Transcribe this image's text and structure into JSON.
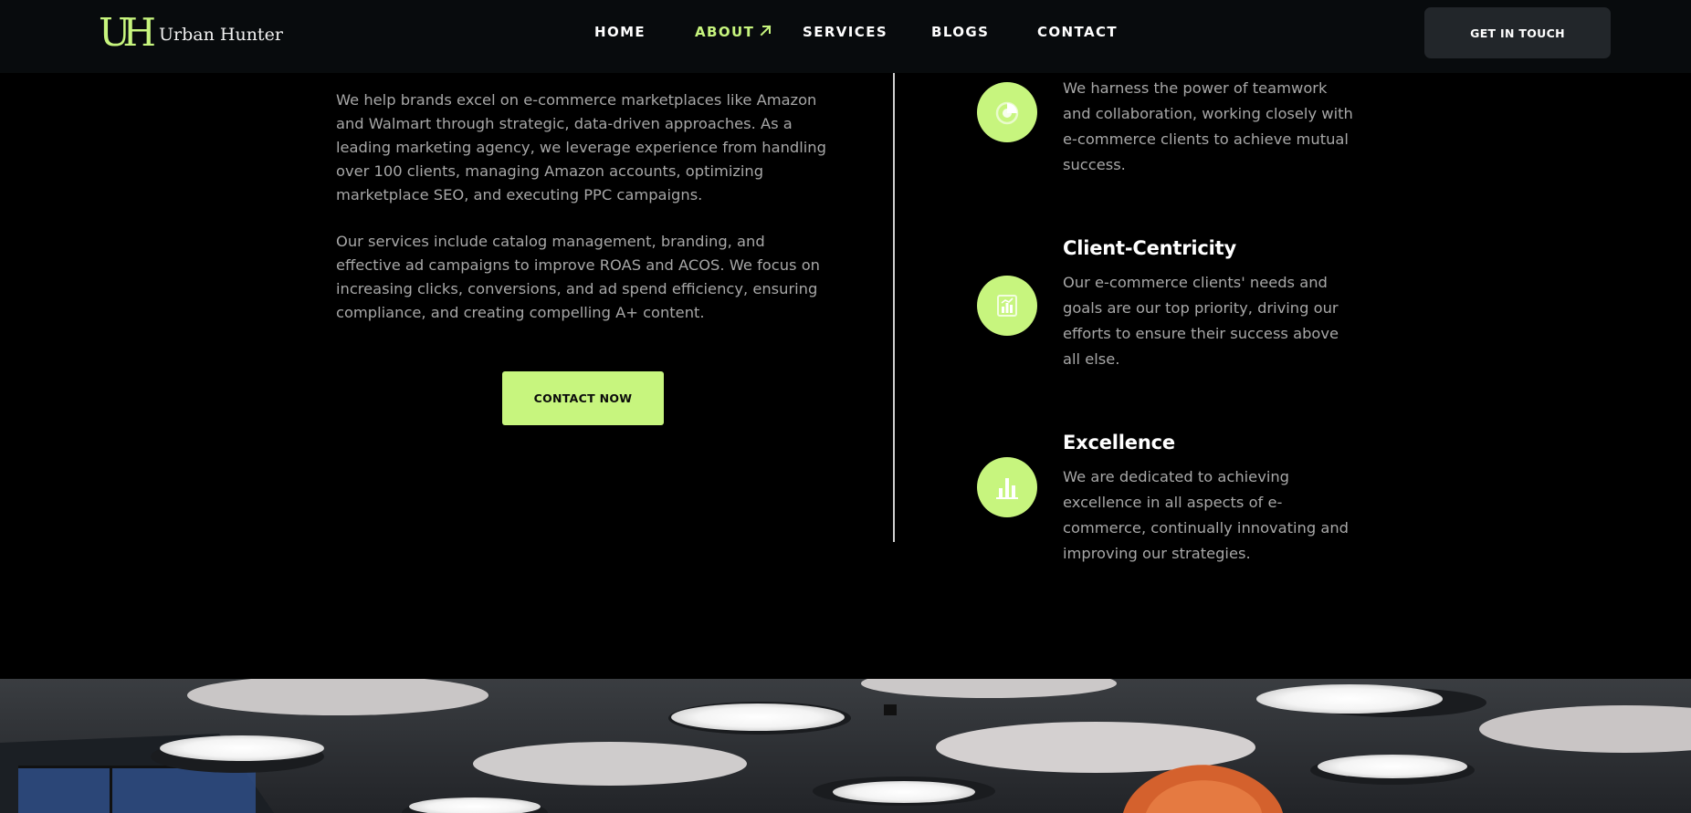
{
  "brand": {
    "mark": "UH",
    "name": "Urban Hunter",
    "accent": "#c7f57e"
  },
  "nav": {
    "items": [
      {
        "label": "HOME",
        "active": false
      },
      {
        "label": "ABOUT",
        "active": true,
        "icon": "arrow-up-right-icon"
      },
      {
        "label": "SERVICES",
        "active": false
      },
      {
        "label": "BLOGS",
        "active": false
      },
      {
        "label": "CONTACT",
        "active": false
      }
    ],
    "cta_label": "GET IN TOUCH"
  },
  "about": {
    "paragraphs": [
      "We help brands excel on e-commerce marketplaces like Amazon and Walmart through strategic, data-driven approaches. As a leading marketing agency, we leverage experience from handling over 100 clients, managing Amazon accounts, optimizing marketplace SEO, and executing PPC campaigns.",
      "Our services include catalog management, branding, and effective ad campaigns to improve ROAS and ACOS. We focus on increasing clicks, conversions, and ad spend efficiency, ensuring compliance, and creating compelling A+ content."
    ],
    "cta_label": "CONTACT NOW"
  },
  "values": [
    {
      "title": "",
      "text": "We harness the power of teamwork and collaboration, working closely with e-commerce clients to achieve mutual success.",
      "icon": "pie-chart-icon"
    },
    {
      "title": "Client-Centricity",
      "text": "Our e-commerce clients' needs and goals are our top priority, driving our efforts to ensure their success above all else.",
      "icon": "report-chart-icon"
    },
    {
      "title": "Excellence",
      "text": "We are dedicated to achieving excellence in all aspects of e-commerce, continually innovating and improving our strategies.",
      "icon": "bar-chart-icon"
    }
  ]
}
